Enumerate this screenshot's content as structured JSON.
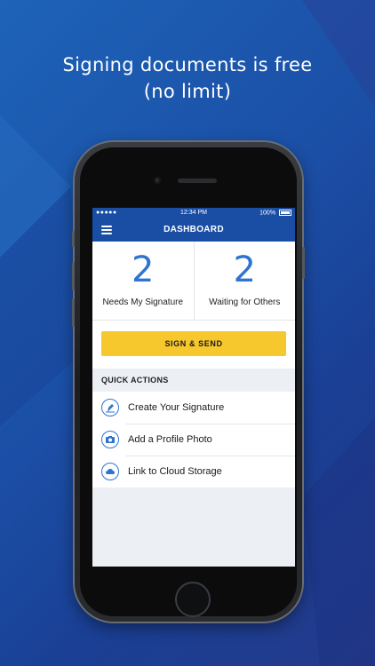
{
  "promo": {
    "headline_line1": "Signing documents is free",
    "headline_line2": "(no limit)"
  },
  "status_bar": {
    "signal": "●●●●● ",
    "time": "12:34 PM",
    "battery": "100%"
  },
  "nav": {
    "title": "DASHBOARD"
  },
  "counts": [
    {
      "value": "2",
      "label": "Needs My Signature"
    },
    {
      "value": "2",
      "label": "Waiting for Others"
    }
  ],
  "cta": {
    "label": "SIGN & SEND"
  },
  "quick_actions": {
    "heading": "QUICK ACTIONS",
    "items": [
      {
        "label": "Create Your Signature",
        "icon": "pen-icon"
      },
      {
        "label": "Add a Profile Photo",
        "icon": "camera-icon"
      },
      {
        "label": "Link to Cloud Storage",
        "icon": "cloud-icon"
      }
    ]
  },
  "colors": {
    "brand_blue": "#1a4ea5",
    "accent_blue": "#2f74d0",
    "cta_yellow": "#f7c72e"
  }
}
